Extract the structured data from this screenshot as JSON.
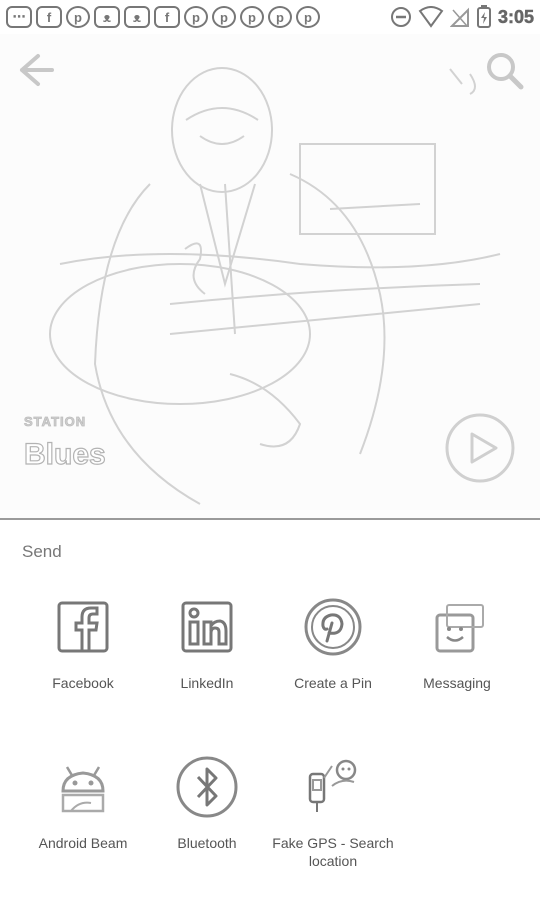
{
  "status_bar": {
    "time": "3:05",
    "notification_icons": [
      {
        "icon": "more-icon",
        "glyph": "⋯"
      },
      {
        "icon": "facebook-icon",
        "glyph": "f"
      },
      {
        "icon": "pinterest-icon",
        "glyph": "p"
      },
      {
        "icon": "cat-app-icon",
        "glyph": "ᴥ"
      },
      {
        "icon": "cat-app-icon",
        "glyph": "ᴥ"
      },
      {
        "icon": "facebook-icon",
        "glyph": "f"
      },
      {
        "icon": "pinterest-icon",
        "glyph": "p"
      },
      {
        "icon": "pinterest-icon",
        "glyph": "p"
      },
      {
        "icon": "pinterest-icon",
        "glyph": "p"
      },
      {
        "icon": "pinterest-icon",
        "glyph": "p"
      },
      {
        "icon": "pinterest-icon",
        "glyph": "p"
      }
    ]
  },
  "hero": {
    "label": "STATION",
    "title": "Blues"
  },
  "share_sheet": {
    "title": "Send",
    "apps": [
      {
        "name": "facebook",
        "label": "Facebook",
        "icon": "facebook-icon"
      },
      {
        "name": "linkedin",
        "label": "LinkedIn",
        "icon": "linkedin-icon"
      },
      {
        "name": "create-a-pin",
        "label": "Create a Pin",
        "icon": "pinterest-icon"
      },
      {
        "name": "messaging",
        "label": "Messaging",
        "icon": "messaging-icon"
      },
      {
        "name": "android-beam",
        "label": "Android Beam",
        "icon": "android-icon"
      },
      {
        "name": "bluetooth",
        "label": "Bluetooth",
        "icon": "bluetooth-icon"
      },
      {
        "name": "fake-gps",
        "label": "Fake GPS - Search location",
        "icon": "fake-gps-icon"
      }
    ]
  }
}
